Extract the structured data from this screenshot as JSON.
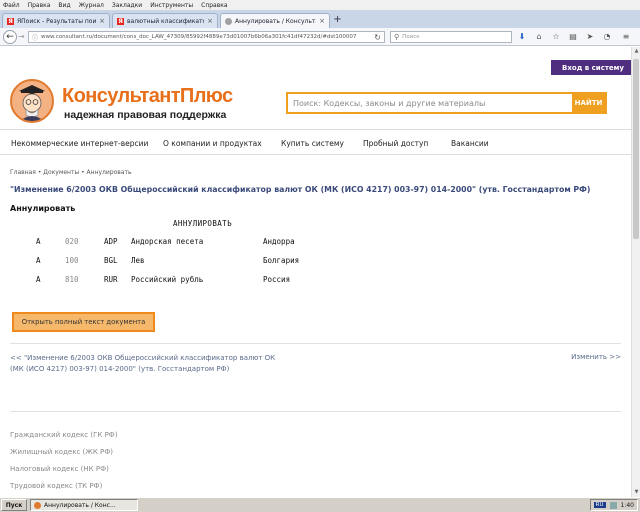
{
  "browser": {
    "menu": [
      "Файл",
      "Правка",
      "Вид",
      "Журнал",
      "Закладки",
      "Инструменты",
      "Справка"
    ],
    "tabs": [
      {
        "label": "ЯПоиск - Результаты пои...",
        "favicon": "yandex-icon"
      },
      {
        "label": "валютный классификатор 2...",
        "favicon": "yandex-icon"
      },
      {
        "label": "Аннулировать / Консультан...",
        "favicon": "consultant-icon",
        "active": true
      }
    ],
    "url": "www.consultant.ru/document/cons_doc_LAW_47309/85992f4889e73d01007b6b06a301fc41df47232d/#dst100007",
    "search_placeholder": "Поиск"
  },
  "header": {
    "login_label": "Вход в систему",
    "logo_text": "КонсультантПлюс",
    "logo_subtitle": "надежная правовая поддержка",
    "search_placeholder": "Поиск: Кодексы, законы и другие материалы",
    "search_button": "НАЙТИ"
  },
  "nav": [
    "Некоммерческие интернет-версии",
    "О компании и продуктах",
    "Купить систему",
    "Пробный доступ",
    "Вакансии"
  ],
  "breadcrumb": {
    "home": "Главная",
    "sep": " • ",
    "docs": "Документы",
    "current": "Аннулировать"
  },
  "document": {
    "title": "\"Изменение 6/2003 ОКВ Общероссийский классификатор валют ОК (МК (ИСО 4217) 003-97) 014-2000\" (утв. Госстандартом РФ)",
    "status_heading": "Аннулировать",
    "table_heading": "АННУЛИРОВАТЬ",
    "rows": [
      {
        "flag": "А",
        "code": "020",
        "alpha": "ADP",
        "name": "Андорская песета",
        "country": "Андорра"
      },
      {
        "flag": "А",
        "code": "100",
        "alpha": "BGL",
        "name": "Лев",
        "country": "Болгария"
      },
      {
        "flag": "А",
        "code": "810",
        "alpha": "RUR",
        "name": "Российский рубль",
        "country": "Россия"
      }
    ],
    "fulltext_button": "Открыть полный текст документа"
  },
  "pager": {
    "prev_line1": "<< \"Изменение 6/2003 ОКВ Общероссийский классификатор валют ОК",
    "prev_line2": "(МК (ИСО 4217) 003-97) 014-2000\" (утв. Госстандартом РФ)",
    "next": "Изменить >>"
  },
  "codexes": [
    "Гражданский кодекс (ГК РФ)",
    "Жилищный кодекс (ЖК РФ)",
    "Налоговый кодекс (НК РФ)",
    "Трудовой кодекс (ТК РФ)"
  ],
  "taskbar": {
    "start": "Пуск",
    "task": "Аннулировать / Конс...",
    "lang": "RU",
    "time": "1:40"
  }
}
